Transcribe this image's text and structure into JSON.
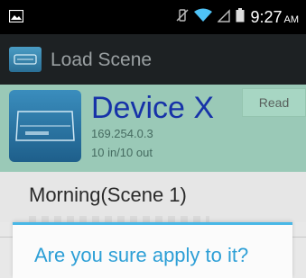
{
  "status_bar": {
    "time": "9:27",
    "ampm": "AM"
  },
  "action_bar": {
    "title": "Load Scene"
  },
  "device": {
    "name": "Device X",
    "ip": "169.254.0.3",
    "io": "10 in/10 out",
    "read_label": "Read"
  },
  "scene": {
    "label": "Morning(Scene 1)"
  },
  "dialog": {
    "title": "Are you sure apply to it?"
  },
  "colors": {
    "status_bg": "#000000",
    "action_bar_bg": "#1d2123",
    "device_card_bg": "#9ac9b7",
    "device_name": "#1632a8",
    "dialog_accent": "#48b7e6",
    "dialog_title": "#2d9fd6"
  },
  "icons": {
    "status_left": "picture-icon",
    "mute": "vibrate-off-icon",
    "wifi": "wifi-icon",
    "signal": "signal-icon",
    "battery": "battery-icon",
    "app": "device-rack-icon",
    "device": "device-rack-icon"
  }
}
